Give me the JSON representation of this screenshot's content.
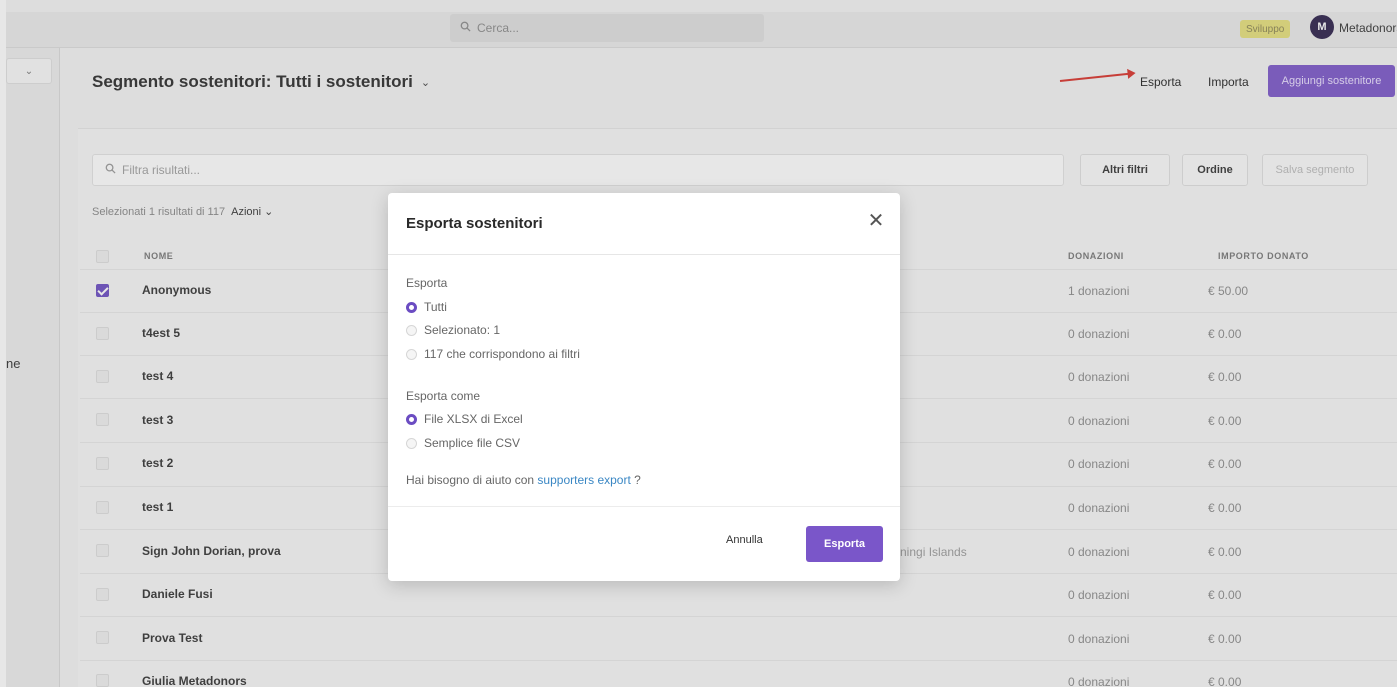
{
  "topbar": {
    "search_placeholder": "Cerca...",
    "env_badge": "Sviluppo",
    "avatar_initial": "M",
    "user_name": "Metadonors"
  },
  "sidebar": {
    "partial_label": "ne"
  },
  "header": {
    "title": "Segmento sostenitori: Tutti i sostenitori",
    "export_label": "Esporta",
    "import_label": "Importa",
    "add_label": "Aggiungi sostenitore"
  },
  "filters": {
    "placeholder": "Filtra risultati...",
    "more_filters": "Altri filtri",
    "order": "Ordine",
    "save_segment": "Salva segmento"
  },
  "selection": {
    "info": "Selezionati 1 risultati di 117",
    "actions": "Azioni"
  },
  "table": {
    "headers": {
      "name": "NOME",
      "donations": "DONAZIONI",
      "amount": "IMPORTO DONATO"
    },
    "rows": [
      {
        "name": "Anonymous",
        "donations": "1 donazioni",
        "amount": "€ 50.00",
        "checked": true
      },
      {
        "name": "t4est 5",
        "donations": "0 donazioni",
        "amount": "€ 0.00",
        "checked": false
      },
      {
        "name": "test 4",
        "donations": "0 donazioni",
        "amount": "€ 0.00",
        "checked": false
      },
      {
        "name": "test 3",
        "donations": "0 donazioni",
        "amount": "€ 0.00",
        "checked": false
      },
      {
        "name": "test 2",
        "donations": "0 donazioni",
        "amount": "€ 0.00",
        "checked": false
      },
      {
        "name": "test 1",
        "donations": "0 donazioni",
        "amount": "€ 0.00",
        "checked": false
      },
      {
        "name": "Sign John Dorian, prova",
        "extra": "ningi Islands",
        "donations": "0 donazioni",
        "amount": "€ 0.00",
        "checked": false
      },
      {
        "name": "Daniele Fusi",
        "donations": "0 donazioni",
        "amount": "€ 0.00",
        "checked": false
      },
      {
        "name": "Prova Test",
        "donations": "0 donazioni",
        "amount": "€ 0.00",
        "checked": false
      },
      {
        "name": "Giulia Metadonors",
        "donations": "0 donazioni",
        "amount": "€ 0.00",
        "checked": false
      }
    ]
  },
  "modal": {
    "title": "Esporta sostenitori",
    "export_section": "Esporta",
    "export_options": [
      "Tutti",
      "Selezionato: 1",
      "117 che corrispondono ai filtri"
    ],
    "export_selected": 0,
    "format_section": "Esporta come",
    "format_options": [
      "File XLSX di Excel",
      "Semplice file CSV"
    ],
    "format_selected": 0,
    "help_prefix": "Hai bisogno di aiuto con ",
    "help_link": "supporters export",
    "help_suffix": " ?",
    "cancel_label": "Annulla",
    "submit_label": "Esporta"
  },
  "colors": {
    "accent": "#7a56c9",
    "link": "#3a87c4",
    "arrow": "#d8312a",
    "badge": "#e6e07a"
  }
}
